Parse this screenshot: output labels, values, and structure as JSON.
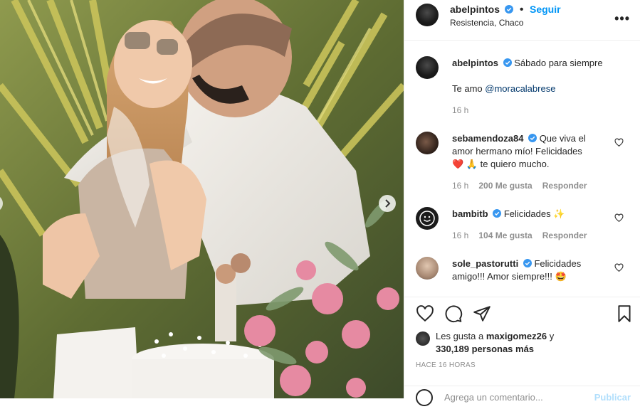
{
  "post": {
    "author": "abelpintos",
    "follow_label": "Seguir",
    "location": "Resistencia, Chaco",
    "more_label": "•••"
  },
  "caption": {
    "author": "abelpintos",
    "text": "Sábado para siempre",
    "line2_prefix": "Te amo ",
    "mention": "@moracalabrese",
    "age": "16 h"
  },
  "comments": [
    {
      "user": "sebamendoza84",
      "text1": "Que viva el",
      "text2": "amor hermano mío! Felicidades",
      "emoji_line": "❤️ 🙏 te quiero mucho.",
      "age": "16 h",
      "likes": "200 Me gusta",
      "reply": "Responder"
    },
    {
      "user": "bambitb",
      "text1": "Felicidades ✨",
      "age": "16 h",
      "likes": "104 Me gusta",
      "reply": "Responder"
    },
    {
      "user": "sole_pastorutti",
      "text1": "Felicidades",
      "text2": "amigo!!! Amor siempre!!! 🤩"
    }
  ],
  "likes": {
    "prefix": "Les gusta a ",
    "user": "maxigomez26",
    "suffix": " y",
    "count": "330,189 personas más"
  },
  "timestamp": "HACE 16 HORAS",
  "add_comment": {
    "placeholder": "Agrega un comentario...",
    "publish": "Publicar"
  },
  "icons": {
    "like": "heart-icon",
    "comment": "comment-icon",
    "share": "send-icon",
    "save": "bookmark-icon",
    "verified": "verified-badge-icon",
    "next": "chevron-right-icon"
  },
  "colors": {
    "link": "#0095f6",
    "verified": "#3897f0",
    "muted": "#8e8e8e"
  }
}
